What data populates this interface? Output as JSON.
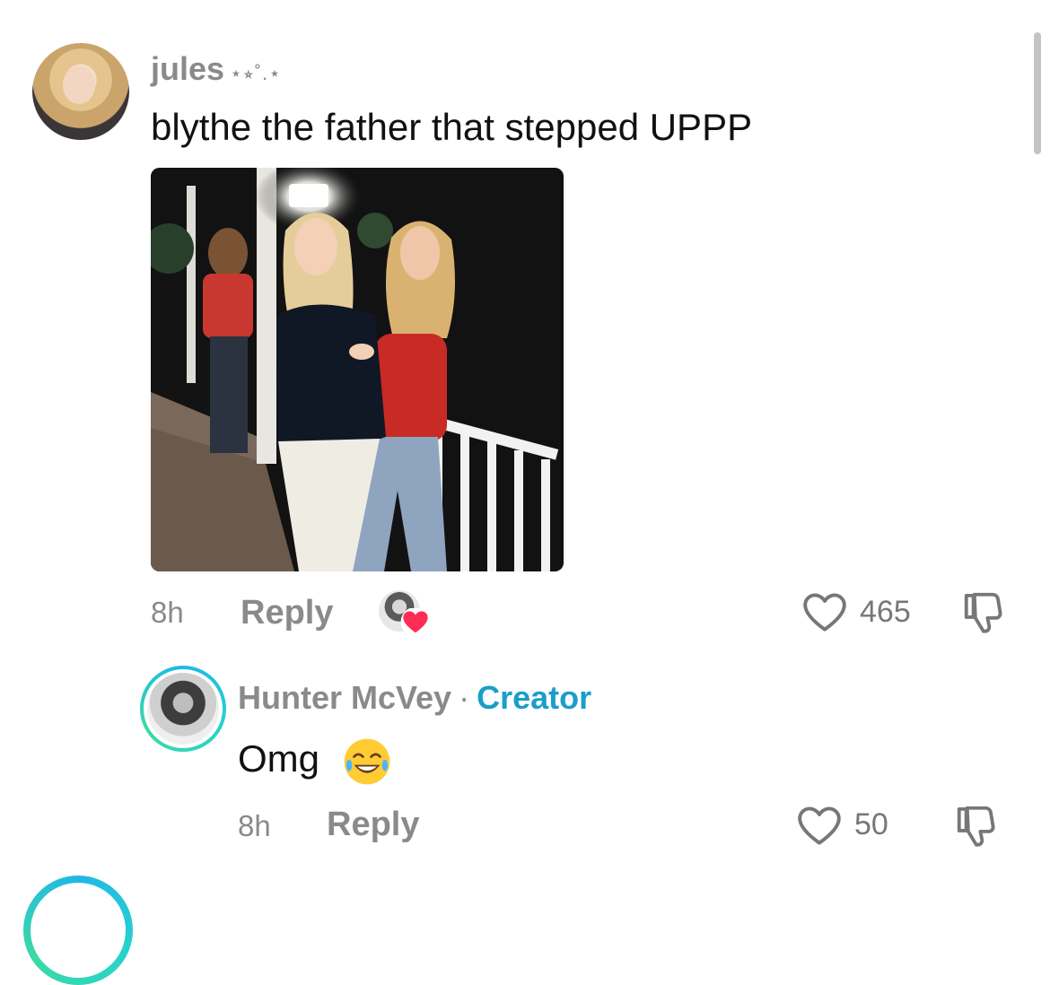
{
  "comment": {
    "username": "jules",
    "username_decoration": "⋆⭒˚.⋆",
    "text": "blythe the father that stepped UPPP",
    "time": "8h",
    "reply_label": "Reply",
    "like_count": "465",
    "liked_by_creator": true
  },
  "reply": {
    "username": "Hunter McVey",
    "separator": "·",
    "badge": "Creator",
    "text": "Omg",
    "emoji": "😂",
    "time": "8h",
    "reply_label": "Reply",
    "like_count": "50"
  },
  "colors": {
    "muted_text": "#8a8a8a",
    "creator_badge": "#1a9ec9",
    "heart_red": "#fe2c55",
    "story_ring": "#29d3c9"
  },
  "icons": {
    "like": "heart-outline-icon",
    "dislike": "thumbs-down-outline-icon",
    "creator_like": "heart-filled-icon"
  }
}
